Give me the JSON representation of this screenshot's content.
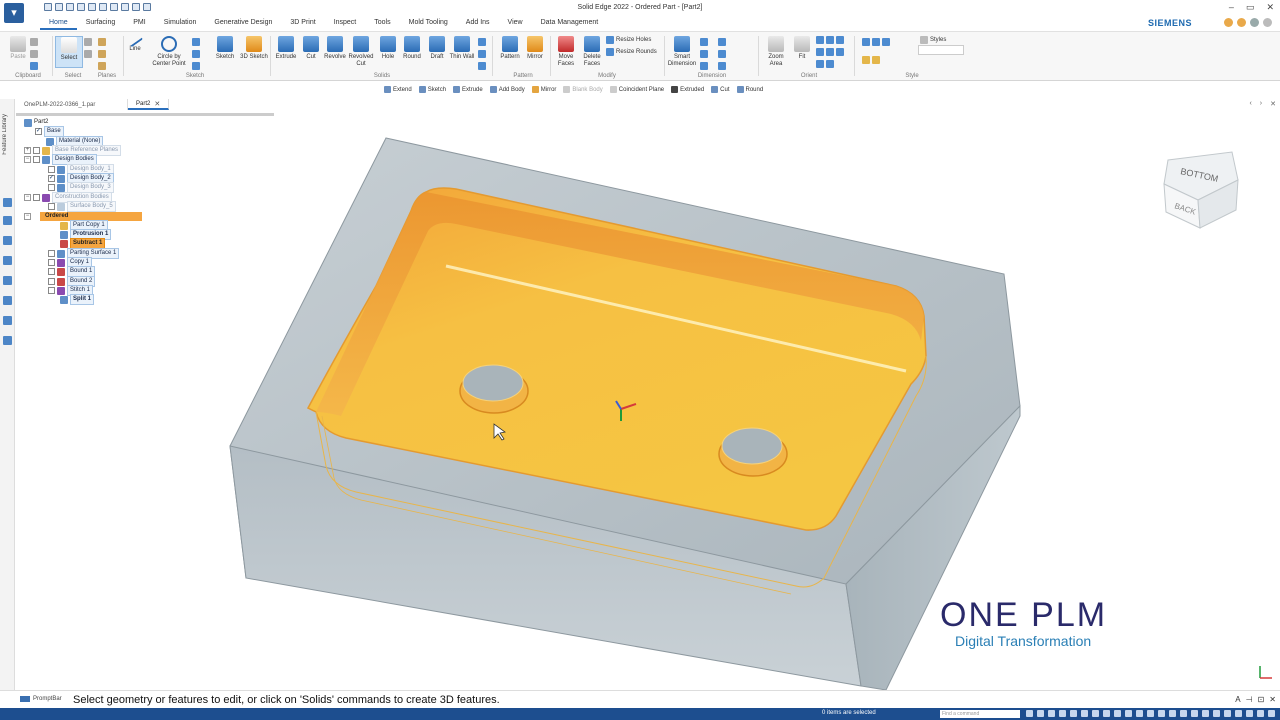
{
  "app": {
    "window_title": "Solid Edge 2022 - Ordered Part - [Part2]",
    "brand": "SIEMENS",
    "win_controls": [
      "–",
      "▭",
      "✕"
    ]
  },
  "ribbon_tabs": [
    "Home",
    "Surfacing",
    "PMI",
    "Simulation",
    "Generative Design",
    "3D Print",
    "Inspect",
    "Tools",
    "Mold Tooling",
    "Add Ins",
    "View",
    "Data Management"
  ],
  "ribbon": {
    "clipboard": {
      "paste": "Paste",
      "group": "Clipboard"
    },
    "select": {
      "select": "Select",
      "group": "Select"
    },
    "planes": {
      "group": "Planes"
    },
    "sketch": {
      "line": "Line",
      "circle": "Circle by Center Point",
      "sketch": "Sketch",
      "sketch3d": "3D Sketch",
      "group": "Sketch"
    },
    "solids": {
      "extrude": "Extrude",
      "cut": "Cut",
      "revolve": "Revolve",
      "revolved_cut": "Revolved Cut",
      "hole": "Hole",
      "round": "Round",
      "draft": "Draft",
      "thin_wall": "Thin Wall",
      "group": "Solids"
    },
    "pattern": {
      "pattern": "Pattern",
      "mirror": "Mirror",
      "group": "Pattern"
    },
    "modify": {
      "move_faces": "Move Faces",
      "delete_faces": "Delete Faces",
      "resize_holes": "Resize Holes",
      "resize_rounds": "Resize Rounds",
      "group": "Modify"
    },
    "dimension": {
      "smart_dimension": "Smart Dimension",
      "group": "Dimension"
    },
    "orient": {
      "zoom_area": "Zoom Area",
      "fit": "Fit",
      "group": "Orient"
    },
    "style": {
      "styles": "Styles",
      "group": "Style"
    }
  },
  "command_bar": [
    {
      "label": "Extend",
      "disabled": false
    },
    {
      "label": "Sketch",
      "disabled": false
    },
    {
      "label": "Extrude",
      "disabled": false
    },
    {
      "label": "Add Body",
      "disabled": false
    },
    {
      "label": "Mirror",
      "disabled": false
    },
    {
      "label": "Blank Body",
      "disabled": true
    },
    {
      "label": "Coincident Plane",
      "disabled": false
    },
    {
      "label": "Extruded",
      "disabled": false
    },
    {
      "label": "Cut",
      "disabled": false
    },
    {
      "label": "Round",
      "disabled": false
    }
  ],
  "doc_tabs": [
    {
      "label": "OnePLM-2022-0366_1.par",
      "active": false
    },
    {
      "label": "Part2",
      "active": true
    }
  ],
  "left_strip": {
    "label": "Feature Library"
  },
  "tree": {
    "root": "Part2",
    "base": "Base",
    "material": "Material (None)",
    "ref_planes": "Base Reference Planes",
    "design_bodies": "Design Bodies",
    "body1": "Design Body_1",
    "body2": "Design Body_2",
    "body3": "Design Body_3",
    "construction": "Construction Bodies",
    "surface5": "Surface Body_5",
    "ordered": "Ordered",
    "part_copy": "Part Copy 1",
    "protrusion": "Protrusion 1",
    "subtract": "Subtract 1",
    "parting": "Parting Surface 1",
    "copy1": "Copy 1",
    "bound1": "Bound 1",
    "bound2": "Bound 2",
    "stitch1": "Stitch 1",
    "split1": "Split 1"
  },
  "view_cube": {
    "top": "BOTTOM",
    "front": "BACK"
  },
  "logo": {
    "main_a": "ONE",
    "main_b": "PLM",
    "sub": "Digital Transformation"
  },
  "prompt": {
    "label": "PromptBar",
    "text": "Select geometry or features to edit, or click on 'Solids' commands to create 3D features."
  },
  "status": {
    "selected": "0 items are selected",
    "find_placeholder": "Find a command"
  },
  "colors": {
    "accent": "#2a6fbd",
    "highlight": "#f5a540",
    "status_bar": "#1d4e8f"
  }
}
